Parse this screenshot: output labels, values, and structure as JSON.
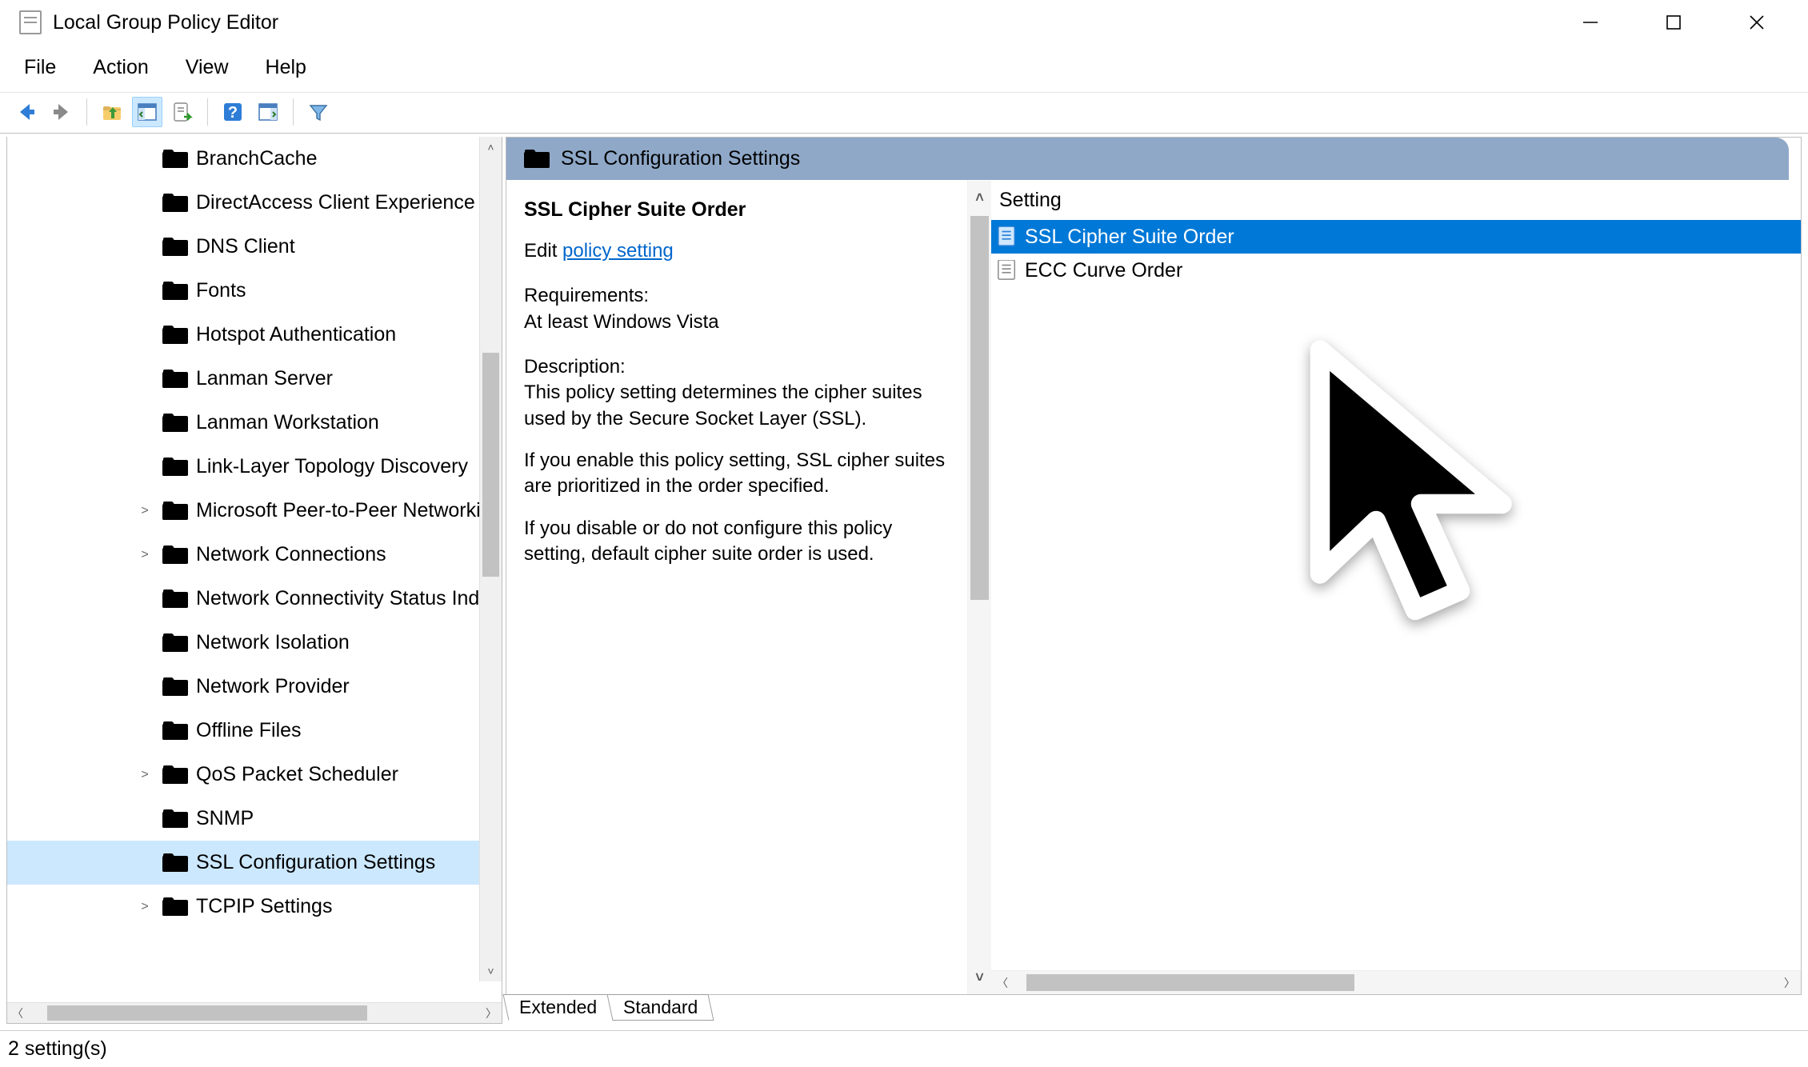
{
  "title": "Local Group Policy Editor",
  "menu": [
    "File",
    "Action",
    "View",
    "Help"
  ],
  "tree": {
    "items": [
      {
        "label": "BranchCache",
        "expandable": false
      },
      {
        "label": "DirectAccess Client Experience Settings",
        "expandable": false
      },
      {
        "label": "DNS Client",
        "expandable": false
      },
      {
        "label": "Fonts",
        "expandable": false
      },
      {
        "label": "Hotspot Authentication",
        "expandable": false
      },
      {
        "label": "Lanman Server",
        "expandable": false
      },
      {
        "label": "Lanman Workstation",
        "expandable": false
      },
      {
        "label": "Link-Layer Topology Discovery",
        "expandable": false
      },
      {
        "label": "Microsoft Peer-to-Peer Networking Services",
        "expandable": true
      },
      {
        "label": "Network Connections",
        "expandable": true
      },
      {
        "label": "Network Connectivity Status Indicator",
        "expandable": false
      },
      {
        "label": "Network Isolation",
        "expandable": false
      },
      {
        "label": "Network Provider",
        "expandable": false
      },
      {
        "label": "Offline Files",
        "expandable": false
      },
      {
        "label": "QoS Packet Scheduler",
        "expandable": true
      },
      {
        "label": "SNMP",
        "expandable": false
      },
      {
        "label": "SSL Configuration Settings",
        "expandable": false,
        "selected": true
      },
      {
        "label": "TCPIP Settings",
        "expandable": true
      }
    ]
  },
  "right": {
    "header": "SSL Configuration Settings",
    "detail": {
      "title": "SSL Cipher Suite Order",
      "edit_prefix": "Edit ",
      "edit_link": "policy setting",
      "requirements_label": "Requirements:",
      "requirements_text": "At least Windows Vista",
      "description_label": "Description:",
      "description_p1": "This policy setting determines the cipher suites used by the Secure Socket Layer (SSL).",
      "description_p2": "If you enable this policy setting, SSL cipher suites are prioritized in the order specified.",
      "description_p3": "If you disable or do not configure this policy setting, default cipher suite order is used."
    },
    "setting_header": "Setting",
    "settings": [
      {
        "label": "SSL Cipher Suite Order",
        "selected": true
      },
      {
        "label": "ECC Curve Order",
        "selected": false
      }
    ]
  },
  "bottom_tabs": {
    "extended": "Extended",
    "standard": "Standard"
  },
  "status": "2 setting(s)"
}
